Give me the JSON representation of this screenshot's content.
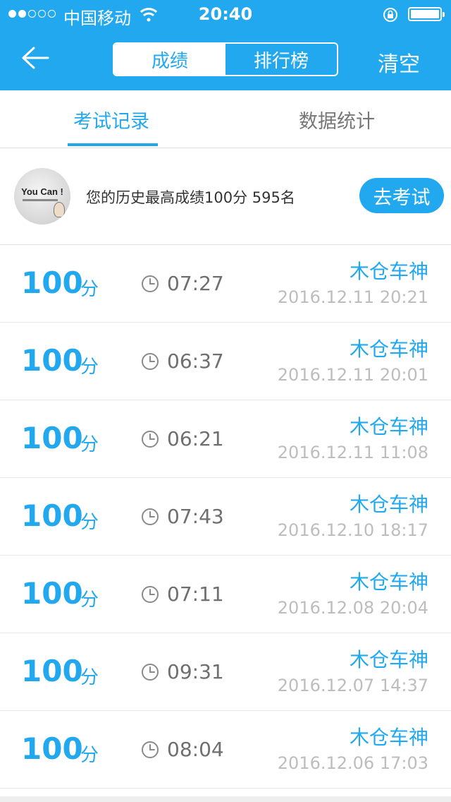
{
  "status_bar": {
    "carrier": "中国移动",
    "time": "20:40"
  },
  "nav": {
    "segments": [
      "成绩",
      "排行榜"
    ],
    "active_segment": "成绩",
    "clear_label": "清空"
  },
  "tabs": {
    "items": [
      "考试记录",
      "数据统计"
    ],
    "active": "考试记录"
  },
  "best": {
    "avatar_text": "You Can !",
    "summary": "您的历史最高成绩100分  595名",
    "exam_button": "去考试"
  },
  "records": [
    {
      "score": "100",
      "unit": "分",
      "duration": "07:27",
      "user": "木仓车神",
      "datetime": "2016.12.11 20:21"
    },
    {
      "score": "100",
      "unit": "分",
      "duration": "06:37",
      "user": "木仓车神",
      "datetime": "2016.12.11 20:01"
    },
    {
      "score": "100",
      "unit": "分",
      "duration": "06:21",
      "user": "木仓车神",
      "datetime": "2016.12.11 11:08"
    },
    {
      "score": "100",
      "unit": "分",
      "duration": "07:43",
      "user": "木仓车神",
      "datetime": "2016.12.10 18:17"
    },
    {
      "score": "100",
      "unit": "分",
      "duration": "07:11",
      "user": "木仓车神",
      "datetime": "2016.12.08 20:04"
    },
    {
      "score": "100",
      "unit": "分",
      "duration": "09:31",
      "user": "木仓车神",
      "datetime": "2016.12.07 14:37"
    },
    {
      "score": "100",
      "unit": "分",
      "duration": "08:04",
      "user": "木仓车神",
      "datetime": "2016.12.06 17:03"
    }
  ],
  "colors": {
    "accent": "#22a8ef",
    "muted_text": "#bdbdbd"
  }
}
